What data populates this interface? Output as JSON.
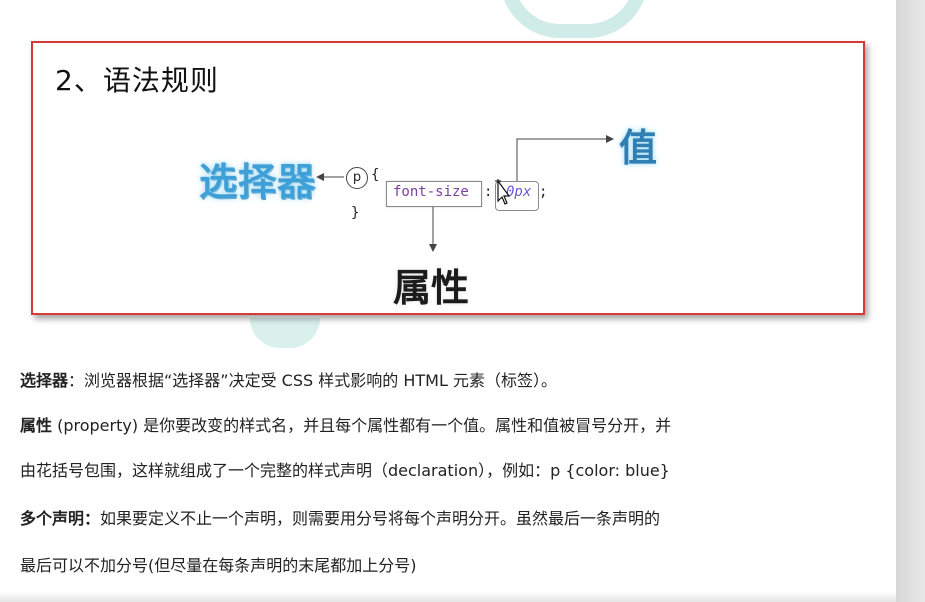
{
  "slide": {
    "title": "2、语法规则",
    "label_selector": "选择器",
    "label_value": "值",
    "label_property": "属性",
    "code_p": "p",
    "code_brace_open": "{",
    "code_property": "font-size",
    "code_colon": ":",
    "code_value": "0px",
    "code_semicolon": ";",
    "code_brace_close": "}"
  },
  "paragraphs": {
    "selector_term": "选择器",
    "selector_desc": "：浏览器根据“选择器”决定受 CSS 样式影响的 HTML 元素（标签）。",
    "property_term": "属性",
    "property_desc_1": " (property) 是你要改变的样式名，并且每个属性都有一个值。属性和值被冒号分开，并",
    "property_desc_2": "由花括号包围，这样就组成了一个完整的样式声明（declaration），例如：p {color: blue}",
    "multi_term": "多个声明：",
    "multi_desc_1": "如果要定义不止一个声明，则需要用分号将每个声明分开。虽然最后一条声明的",
    "multi_desc_2": "最后可以不加分号(但尽量在每条声明的末尾都加上分号)"
  },
  "colors": {
    "slide_border": "#d43b36",
    "selector_label": "#3fa0d8",
    "value_label": "#2f7fb2",
    "property_code": "#7b3f9e",
    "value_code": "#6a5bd6",
    "watermark": "#cfece8"
  },
  "icons": {
    "cursor": "move-cursor-icon"
  }
}
